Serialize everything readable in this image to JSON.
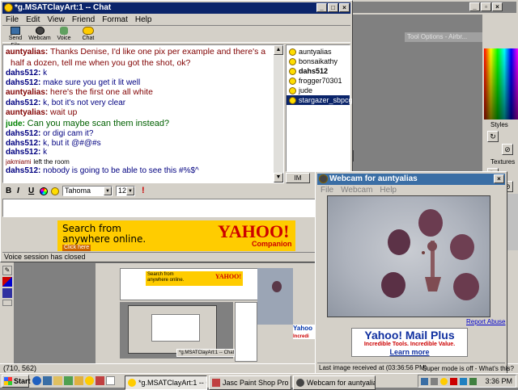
{
  "desktop": {
    "bg": "#808080"
  },
  "chat_window": {
    "title": "*g.MSATClayArt:1 -- Chat",
    "menu": [
      "File",
      "Edit",
      "View",
      "Friend",
      "Format",
      "Help"
    ],
    "toolbar": [
      "Send File",
      "Webcam",
      "Voice",
      "Chat"
    ],
    "messages": [
      {
        "name": "auntyalias:",
        "text": "Thanks Denise, I'd like one pix per example and there's a",
        "style": "au"
      },
      {
        "name": "",
        "text": "half a dozen, tell me when you got the shot, ok?",
        "style": "au"
      },
      {
        "name": "dahs512:",
        "text": "k",
        "style": "dh"
      },
      {
        "name": "dahs512:",
        "text": "make sure you get it lit well",
        "style": "dh"
      },
      {
        "name": "auntyalias:",
        "text": "here's the first one all white",
        "style": "au"
      },
      {
        "name": "dahs512:",
        "text": "k, bot it's not very clear",
        "style": "dh"
      },
      {
        "name": "auntyalias:",
        "text": "wait up",
        "style": "au"
      },
      {
        "name": "jude:",
        "text": "Can you maybe scan them instead?",
        "style": "ju"
      },
      {
        "name": "dahs512:",
        "text": "or digi cam it?",
        "style": "dh"
      },
      {
        "name": "dahs512:",
        "text": "k, but it @#@#s",
        "style": "dh"
      },
      {
        "name": "dahs512:",
        "text": "k",
        "style": "dh"
      },
      {
        "name": "jakmiami",
        "text": "left the room",
        "style": "sys"
      },
      {
        "name": "dahs512:",
        "text": "nobody is going to be able to see this #%$^",
        "style": "dh"
      }
    ],
    "buddies": [
      "auntyalias",
      "bonsaikathy",
      "dahs512",
      "frogger70301",
      "jude",
      "stargazer_sbpcg"
    ],
    "im_button": "IM",
    "font_name": "Tahoma",
    "font_size": "12",
    "format_buttons": [
      "B",
      "I",
      "U"
    ],
    "ad": {
      "line1": "Search from",
      "line2": "anywhere online.",
      "link": "Click here",
      "brand": "YAHOO!",
      "sub": "Companion"
    },
    "status": "Voice session has closed"
  },
  "webcam_window": {
    "title": "Webcam for auntyalias",
    "menu": [
      "File",
      "Webcam",
      "Help"
    ],
    "report": "Report Abuse",
    "ad": {
      "title": "Yahoo! Mail Plus",
      "sub": "Incredible Tools. Incredible Value.",
      "more": "Learn more"
    },
    "status_left": "Last image received at (03:36:56 PM)",
    "status_right": "Super mode is off - What's this?"
  },
  "psp": {
    "tool_options": "Tool Options - Airbr...",
    "styles_label": "Styles",
    "textures_label": "Textures",
    "coords": "(710, 562)"
  },
  "taskbar": {
    "start": "Start",
    "tasks": [
      "*g.MSATClayArt:1 -- Chat",
      "Jasc Paint Shop Pro - Ima...",
      "Webcam for auntyalias"
    ],
    "clock": "3:36 PM"
  },
  "colors": {
    "title_active": "#0a246a",
    "title_inactive": "#808080",
    "yahoo_red": "#cc0000",
    "ad_yellow": "#ffcc00"
  }
}
